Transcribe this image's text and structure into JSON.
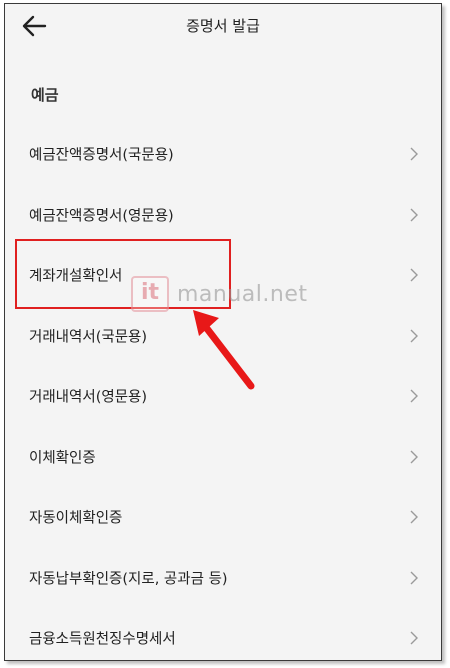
{
  "header": {
    "title": "증명서 발급",
    "back_icon": "arrow-left-icon"
  },
  "section": {
    "title": "예금"
  },
  "items": [
    {
      "label": "예금잔액증명서(국문용)"
    },
    {
      "label": "예금잔액증명서(영문용)"
    },
    {
      "label": "계좌개설확인서"
    },
    {
      "label": "거래내역서(국문용)"
    },
    {
      "label": "거래내역서(영문용)"
    },
    {
      "label": "이체확인증"
    },
    {
      "label": "자동이체확인증"
    },
    {
      "label": "자동납부확인증(지로, 공과금 등)"
    },
    {
      "label": "금융소득원천징수명세서"
    }
  ],
  "watermark": {
    "logo_text": "it",
    "text": "manual.net"
  },
  "colors": {
    "highlight": "#e02020",
    "background": "#f4f4f4",
    "chevron": "#9a9a9a"
  }
}
